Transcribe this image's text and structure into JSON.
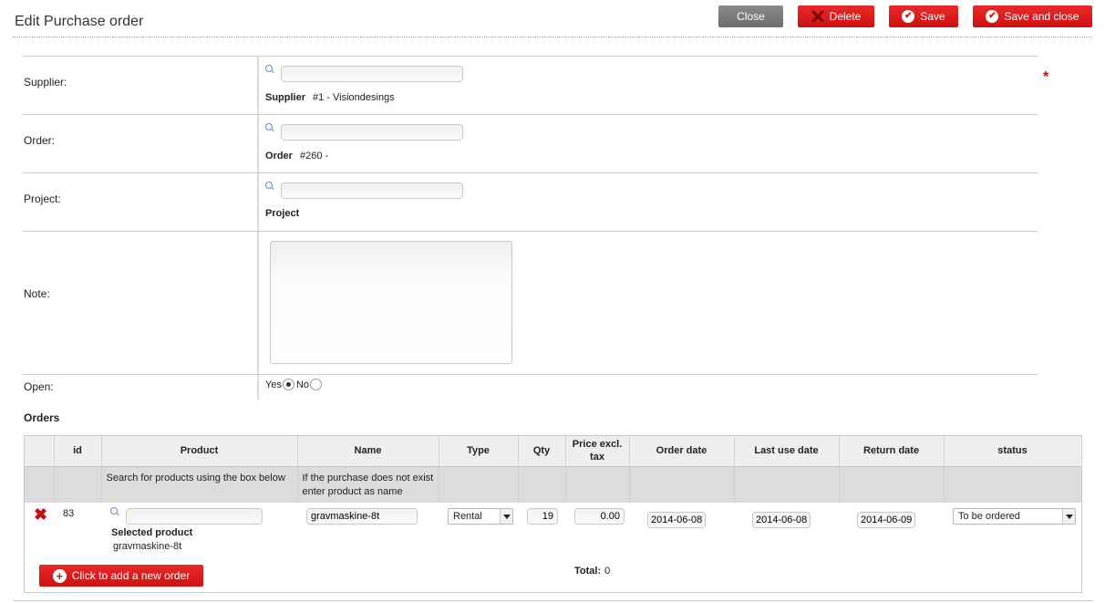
{
  "page": {
    "title": "Edit Purchase order"
  },
  "toolbar": {
    "close_label": "Close",
    "delete_label": "Delete",
    "save_label": "Save",
    "save_close_label": "Save and close"
  },
  "form": {
    "supplier": {
      "label": "Supplier:",
      "search_value": "",
      "selected_label": "Supplier",
      "selected_value": "#1 - Visiondesings"
    },
    "order": {
      "label": "Order:",
      "search_value": "",
      "selected_label": "Order",
      "selected_value": "#260 -"
    },
    "project": {
      "label": "Project:",
      "search_value": "",
      "selected_label": "Project",
      "selected_value": ""
    },
    "note": {
      "label": "Note:",
      "value": ""
    },
    "open": {
      "label": "Open:",
      "yes_label": "Yes",
      "no_label": "No",
      "selected": "Yes"
    },
    "required_marker": "*"
  },
  "orders": {
    "heading": "Orders",
    "columns": [
      "",
      "id",
      "Product",
      "Name",
      "Type",
      "Qty",
      "Price excl. tax",
      "Order date",
      "Last use date",
      "Return date",
      "status"
    ],
    "hints": {
      "product": "Search for products using the box below",
      "name": "If the purchase does not exist enter product as name"
    },
    "rows": [
      {
        "delete_icon": "✖",
        "id": "83",
        "product_search": "",
        "selected_product_label": "Selected product",
        "selected_product_value": "gravmaskine-8t",
        "name": "gravmaskine-8t",
        "type": "Rental",
        "qty": "19",
        "price": "0.00",
        "order_date": "2014-06-08",
        "last_use_date": "2014-06-08",
        "return_date": "2014-06-09",
        "status": "To be ordered"
      }
    ],
    "add_button_label": "Click to add a new order",
    "total_label": "Total:",
    "total_value": "0"
  },
  "colors": {
    "accent_red": "#d31414",
    "close_gray": "#7a7a7a"
  },
  "icons": {
    "search": "magnifier-icon",
    "delete": "x-icon",
    "save": "check-circle-icon",
    "add": "plus-circle-icon"
  }
}
